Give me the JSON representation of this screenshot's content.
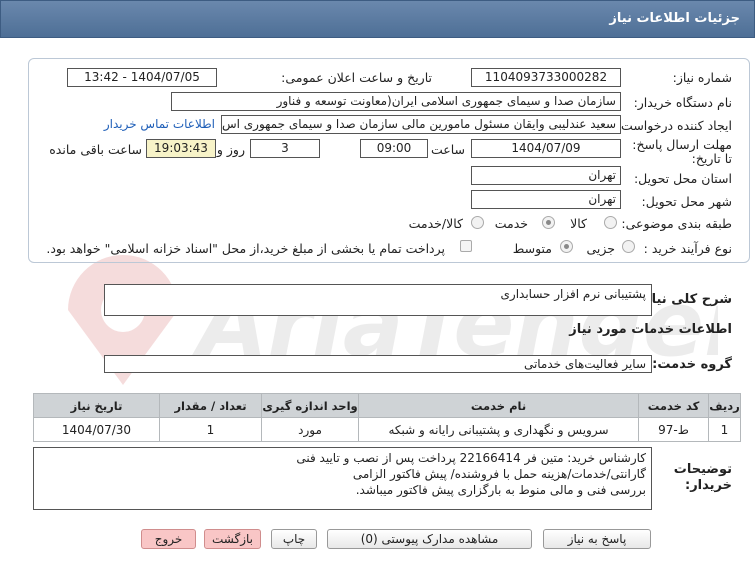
{
  "header": {
    "title": "جزئیات اطلاعات نیاز"
  },
  "form": {
    "need_number_label": "شماره نیاز:",
    "need_number": "1104093733000282",
    "announce_label": "تاریخ و ساعت اعلان عمومی:",
    "announce_value": "1404/07/05 - 13:42",
    "buyer_label": "نام دستگاه خریدار:",
    "buyer_value": "سازمان صدا و سیمای جمهوری اسلامی ایران(معاونت توسعه و فناور",
    "creator_label": "ایجاد کننده درخواست:",
    "creator_value": "سعید عندلیبی وایقان مسئول مامورین مالی  سازمان صدا و سیمای جمهوری اس",
    "contact_link": "اطلاعات تماس خریدار",
    "deadline_label": "مهلت ارسال پاسخ: تا تاریخ:",
    "deadline_date": "1404/07/09",
    "time_label": "ساعت",
    "deadline_time": "09:00",
    "days_value": "3",
    "days_label": "روز و",
    "remaining_time": "19:03:43",
    "remaining_label": "ساعت باقی مانده",
    "province_label": "استان محل تحویل:",
    "province_value": "تهران",
    "city_label": "شهر محل تحویل:",
    "city_value": "تهران",
    "category_label": "طبقه بندی موضوعی:",
    "category_options": [
      "کالا",
      "خدمت",
      "کالا/خدمت"
    ],
    "process_label": "نوع فرآیند خرید :",
    "process_options": [
      "جزیی",
      "متوسط"
    ],
    "payment_note": "پرداخت تمام یا بخشی از مبلغ خرید،از محل \"اسناد خزانه اسلامی\" خواهد بود."
  },
  "summary": {
    "label": "شرح کلی نیاز:",
    "value": "پشتیبانی نرم افزار حسابداری"
  },
  "services": {
    "section_title": "اطلاعات خدمات مورد نیاز",
    "group_label": "گروه خدمت:",
    "group_value": "سایر فعالیت‌های خدماتی",
    "columns": [
      "ردیف",
      "کد خدمت",
      "نام خدمت",
      "واحد اندازه گیری",
      "تعداد / مقدار",
      "تاریخ نیاز"
    ],
    "rows": [
      [
        "1",
        "ط-97",
        "سرویس و نگهداری و پشتیبانی رایانه و شبکه",
        "مورد",
        "1",
        "1404/07/30"
      ]
    ]
  },
  "notes": {
    "label": "توضیحات خریدار:",
    "lines": [
      "کارشناس خرید: متین فر 22166414    پرداخت پس از نصب و تایید فنی",
      "گارانتی/خدمات/هزینه حمل با فروشنده/ پیش فاکتور الزامی",
      "بررسی فنی و مالی منوط به بارگزاری پیش فاکتور میباشد."
    ]
  },
  "buttons": {
    "reply": "پاسخ به نیاز",
    "attachments": "مشاهده مدارک پیوستی (0)",
    "print": "چاپ",
    "back": "بازگشت",
    "exit": "خروج"
  }
}
